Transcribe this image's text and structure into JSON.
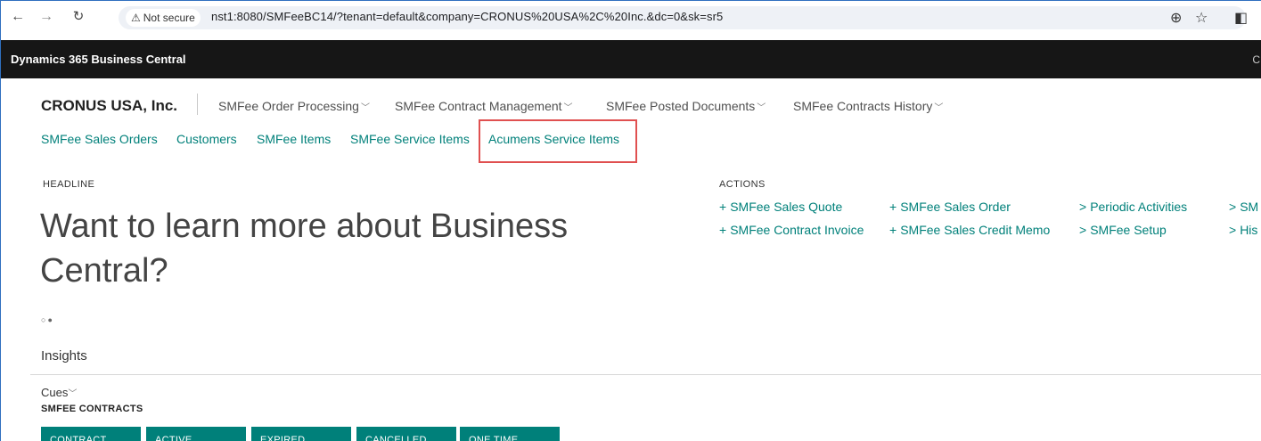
{
  "browser": {
    "back_icon": "arrow-left-icon",
    "forward_icon": "arrow-right-icon",
    "reload_icon": "reload-icon",
    "security_label": "Not secure",
    "url": "nst1:8080/SMFeeBC14/?tenant=default&company=CRONUS%20USA%2C%20Inc.&dc=0&sk=sr5"
  },
  "app": {
    "title": "Dynamics 365 Business Central",
    "corner_text": "C"
  },
  "rolecenter": {
    "company": "CRONUS USA, Inc.",
    "menus": [
      {
        "label": "SMFee Order Processing"
      },
      {
        "label": "SMFee Contract Management"
      },
      {
        "label": "SMFee Posted Documents"
      },
      {
        "label": "SMFee Contracts History"
      }
    ],
    "links": [
      {
        "label": "SMFee Sales Orders"
      },
      {
        "label": "Customers"
      },
      {
        "label": "SMFee Items"
      },
      {
        "label": "SMFee Service Items"
      },
      {
        "label": "Acumens Service Items"
      }
    ],
    "highlight_color": "#e05050"
  },
  "headline": {
    "caption": "HEADLINE",
    "text": "Want to learn more about Business Central?"
  },
  "actions": {
    "caption": "ACTIONS",
    "items": [
      {
        "symbol": "+",
        "label": "SMFee Sales Quote"
      },
      {
        "symbol": "+",
        "label": "SMFee Sales Order"
      },
      {
        "symbol": ">",
        "label": "Periodic Activities"
      },
      {
        "symbol": ">",
        "label": "SM"
      },
      {
        "symbol": "+",
        "label": "SMFee Contract Invoice"
      },
      {
        "symbol": "+",
        "label": "SMFee Sales Credit Memo"
      },
      {
        "symbol": ">",
        "label": "SMFee Setup"
      },
      {
        "symbol": ">",
        "label": "His"
      }
    ]
  },
  "insights": {
    "title": "Insights",
    "cues_label": "Cues",
    "cue_group": "SMFEE CONTRACTS",
    "tiles": [
      {
        "label": "CONTRACT"
      },
      {
        "label": "ACTIVE"
      },
      {
        "label": "EXPIRED"
      },
      {
        "label": "CANCELLED"
      },
      {
        "label": "ONE TIME"
      }
    ]
  },
  "colors": {
    "accent": "#00807a",
    "appbar": "#161616"
  }
}
